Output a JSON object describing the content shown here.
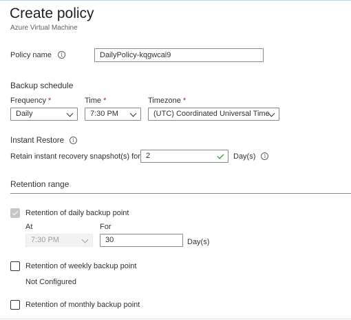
{
  "header": {
    "title": "Create policy",
    "subtitle": "Azure Virtual Machine"
  },
  "policy_name": {
    "label": "Policy name",
    "value": "DailyPolicy-kqgwcai9"
  },
  "backup_schedule": {
    "heading": "Backup schedule",
    "frequency_label": "Frequency",
    "frequency_value": "Daily",
    "time_label": "Time",
    "time_value": "7:30 PM",
    "timezone_label": "Timezone",
    "timezone_value": "(UTC) Coordinated Universal Time",
    "required_mark": "*"
  },
  "instant_restore": {
    "heading": "Instant Restore",
    "retain_label": "Retain instant recovery snapshot(s) for",
    "retain_value": "2",
    "unit": "Day(s)"
  },
  "retention_range": {
    "heading": "Retention range",
    "daily": {
      "label": "Retention of daily backup point",
      "checked": true,
      "at_label": "At",
      "at_value": "7:30 PM",
      "for_label": "For",
      "for_value": "30",
      "unit": "Day(s)"
    },
    "weekly": {
      "label": "Retention of weekly backup point",
      "checked": false,
      "status": "Not Configured"
    },
    "monthly": {
      "label": "Retention of monthly backup point",
      "checked": false
    }
  },
  "icons": {
    "info": "info-icon",
    "dropdown": "chevron-down-icon",
    "valid": "checkmark-icon"
  },
  "colors": {
    "required": "#a4262c",
    "valid_check": "#107c10",
    "disabled_fill": "#c8c6c4"
  }
}
